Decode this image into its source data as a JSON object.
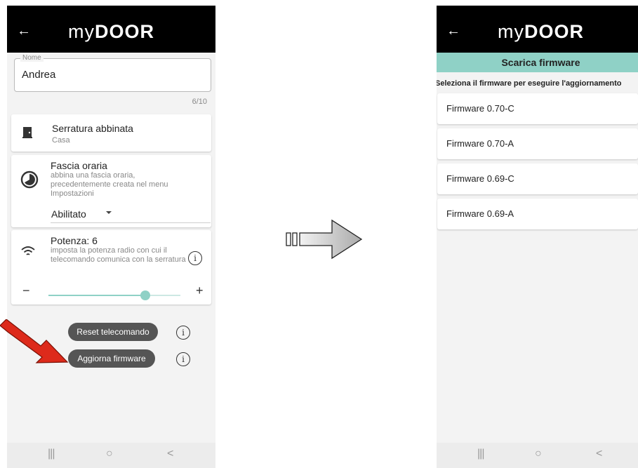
{
  "left": {
    "header": {
      "back_icon": "←",
      "logo_light": "my",
      "logo_bold": "DOOR"
    },
    "name_field": {
      "label": "Nome",
      "value": "Andrea",
      "counter": "6/10"
    },
    "lock_card": {
      "title": "Serratura abbinata",
      "subtitle": "Casa",
      "icon": "door-icon"
    },
    "timeslot_card": {
      "title": "Fascia oraria",
      "desc": "abbina una fascia oraria, precedentemente creata nel menu Impostazioni",
      "select_value": "Abilitato",
      "icon": "clock-icon"
    },
    "power_card": {
      "title": "Potenza: 6",
      "desc": "imposta la potenza radio con cui il telecomando comunica con la serratura",
      "minus": "−",
      "plus": "+",
      "level": 6,
      "max": 8,
      "icon": "wifi-icon"
    },
    "buttons": {
      "reset": "Reset telecomando",
      "update": "Aggiorna firmware"
    },
    "nav": {
      "recent": "|||",
      "home": "○",
      "back": "<"
    }
  },
  "right": {
    "header": {
      "back_icon": "←",
      "logo_light": "my",
      "logo_bold": "DOOR"
    },
    "banner": "Scarica firmware",
    "instruction": "Seleziona il firmware per eseguire l'aggiornamento",
    "firmwares": [
      "Firmware 0.70-C",
      "Firmware 0.70-A",
      "Firmware 0.69-C",
      "Firmware 0.69-A"
    ],
    "nav": {
      "recent": "|||",
      "home": "○",
      "back": "<"
    }
  },
  "colors": {
    "accent": "#8fd1c6",
    "appbar": "#000000",
    "pill": "#555555",
    "arrow_red": "#dd2a1b"
  }
}
